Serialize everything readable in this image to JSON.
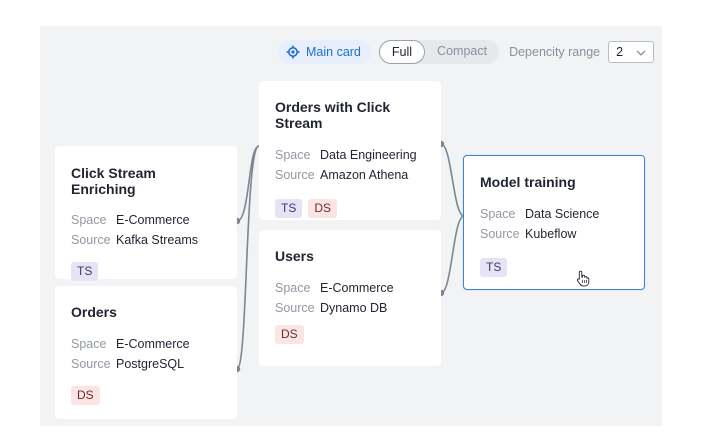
{
  "toolbar": {
    "main_card_label": "Main card",
    "view_modes": [
      "Full",
      "Compact"
    ],
    "active_view_mode": "Full",
    "range_label": "Depencity range",
    "range_value": "2"
  },
  "cards": {
    "click_stream": {
      "title": "Click Stream Enriching",
      "space_label": "Space",
      "space": "E-Commerce",
      "source_label": "Source",
      "source": "Kafka Streams",
      "tags": [
        "TS"
      ]
    },
    "orders": {
      "title": "Orders",
      "space_label": "Space",
      "space": "E-Commerce",
      "source_label": "Source",
      "source": "PostgreSQL",
      "tags": [
        "DS"
      ]
    },
    "orders_click": {
      "title": "Orders with Click Stream",
      "space_label": "Space",
      "space": "Data Engineering",
      "source_label": "Source",
      "source": "Amazon Athena",
      "tags": [
        "TS",
        "DS"
      ]
    },
    "users": {
      "title": "Users",
      "space_label": "Space",
      "space": "E-Commerce",
      "source_label": "Source",
      "source": "Dynamo DB",
      "tags": [
        "DS"
      ]
    },
    "model_training": {
      "title": "Model training",
      "space_label": "Space",
      "space": "Data Science",
      "source_label": "Source",
      "source": "Kubeflow",
      "tags": [
        "TS"
      ],
      "selected": true
    }
  },
  "colors": {
    "accent": "#1f6fd1",
    "selected_border": "#3a86d6",
    "edge": "#7d8593",
    "ts_tag": "#e6e3f6",
    "ds_tag": "#fbe4e4"
  }
}
